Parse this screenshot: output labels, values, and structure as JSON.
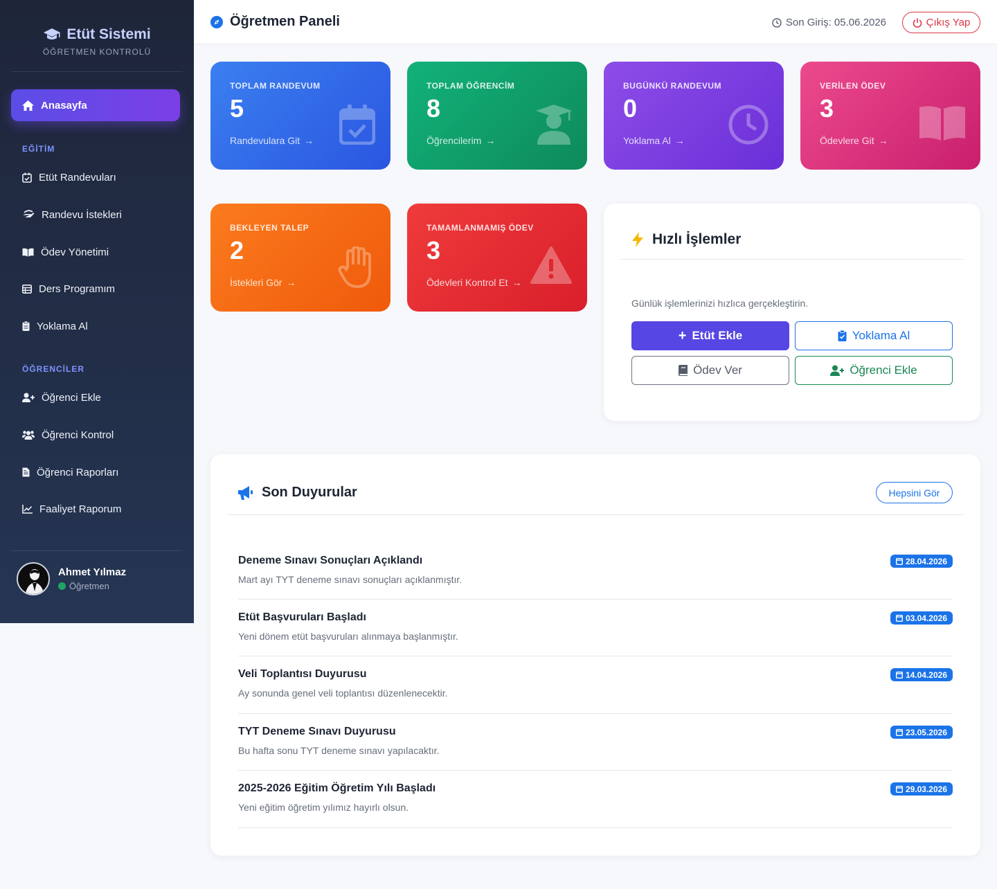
{
  "brand": {
    "title": "Etüt Sistemi",
    "subtitle": "ÖĞRETMEN KONTROLÜ"
  },
  "nav": {
    "home": "Anasayfa",
    "section_education": "EĞİTİM",
    "section_students": "ÖĞRENCİLER",
    "items": [
      "Etüt Randevuları",
      "Randevu İstekleri",
      "Ödev Yönetimi",
      "Ders Programım",
      "Yoklama Al",
      "Öğrenci Ekle",
      "Öğrenci Kontrol",
      "Öğrenci Raporları",
      "Faaliyet Raporum"
    ]
  },
  "user": {
    "name": "Ahmet Yılmaz",
    "role": "Öğretmen"
  },
  "topbar": {
    "title": "Öğretmen Paneli",
    "last_login": "Son Giriş: 05.06.2026",
    "logout": "Çıkış Yap"
  },
  "stats": [
    {
      "label": "TOPLAM RANDEVUM",
      "value": "5",
      "link": "Randevulara Git"
    },
    {
      "label": "TOPLAM ÖĞRENCİM",
      "value": "8",
      "link": "Öğrencilerim"
    },
    {
      "label": "BUGÜNKÜ RANDEVUM",
      "value": "0",
      "link": "Yoklama Al"
    },
    {
      "label": "VERİLEN ÖDEV",
      "value": "3",
      "link": "Ödevlere Git"
    },
    {
      "label": "BEKLEYEN TALEP",
      "value": "2",
      "link": "İstekleri Gör"
    },
    {
      "label": "TAMAMLANMAMIŞ ÖDEV",
      "value": "3",
      "link": "Ödevleri Kontrol Et"
    }
  ],
  "quick": {
    "title": "Hızlı İşlemler",
    "subtitle": "Günlük işlemlerinizi hızlıca gerçekleştirin.",
    "add_study": "Etüt Ekle",
    "attendance": "Yoklama Al",
    "homework": "Ödev Ver",
    "add_student": "Öğrenci Ekle"
  },
  "announcements": {
    "title": "Son Duyurular",
    "see_all": "Hepsini Gör",
    "items": [
      {
        "title": "Deneme Sınavı Sonuçları Açıklandı",
        "text": "Mart ayı TYT deneme sınavı sonuçları açıklanmıştır.",
        "date": "28.04.2026"
      },
      {
        "title": "Etüt Başvuruları Başladı",
        "text": "Yeni dönem etüt başvuruları alınmaya başlanmıştır.",
        "date": "03.04.2026"
      },
      {
        "title": "Veli Toplantısı Duyurusu",
        "text": "Ay sonunda genel veli toplantısı düzenlenecektir.",
        "date": "14.04.2026"
      },
      {
        "title": "TYT Deneme Sınavı Duyurusu",
        "text": "Bu hafta sonu TYT deneme sınavı yapılacaktır.",
        "date": "23.05.2026"
      },
      {
        "title": "2025-2026 Eğitim Öğretim Yılı Başladı",
        "text": "Yeni eğitim öğretim yılımız hayırlı olsun.",
        "date": "29.03.2026"
      }
    ]
  },
  "colors": {
    "accent": "#5646e3",
    "primary_blue": "#1b73e8",
    "danger": "#dc3545",
    "success": "#198754",
    "sidebar": "#1e2539"
  }
}
